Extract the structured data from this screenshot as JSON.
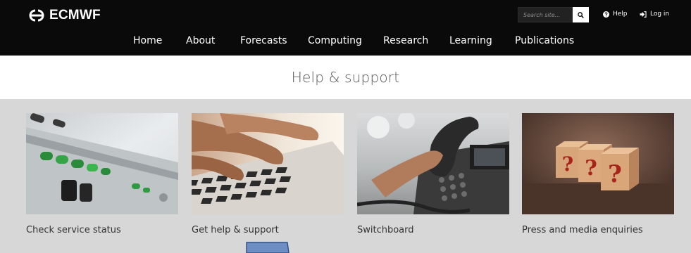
{
  "header": {
    "logo_text": "ECMWF",
    "search_placeholder": "Search site...",
    "help_label": "Help",
    "login_label": "Log in",
    "icons": {
      "logo": "ecmwf-logo-icon",
      "search": "search-icon",
      "help": "question-circle-icon",
      "login": "sign-in-icon"
    }
  },
  "nav": {
    "items": [
      {
        "label": "Home"
      },
      {
        "label": "About"
      },
      {
        "label": "Forecasts"
      },
      {
        "label": "Computing"
      },
      {
        "label": "Research"
      },
      {
        "label": "Learning"
      },
      {
        "label": "Publications"
      }
    ]
  },
  "page": {
    "title": "Help & support"
  },
  "cards": [
    {
      "label": "Check service status",
      "image": "control-panel-switches-photo"
    },
    {
      "label": "Get help & support",
      "image": "hands-typing-keyboard-photo"
    },
    {
      "label": "Switchboard",
      "image": "hand-on-office-telephone-photo"
    },
    {
      "label": "Press and media enquiries",
      "image": "wooden-question-mark-blocks-photo"
    }
  ],
  "colors": {
    "header_bg": "#0a0a0a",
    "title_band_bg": "#ffffff",
    "cards_band_bg": "#d7d7d7",
    "text_dark": "#333333",
    "cursor_fill": "#6c8ec4"
  }
}
